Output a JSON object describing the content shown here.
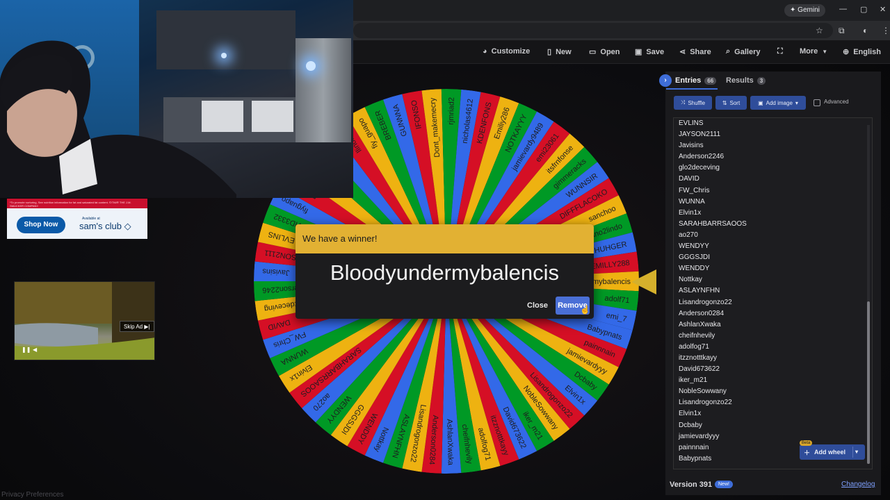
{
  "browser": {
    "gemini_label": "Gemini",
    "window_controls": [
      "—",
      "▢",
      "✕"
    ]
  },
  "toolbar": {
    "items": [
      {
        "label": "Customize",
        "icon": "palette-icon"
      },
      {
        "label": "New",
        "icon": "document-icon"
      },
      {
        "label": "Open",
        "icon": "folder-icon"
      },
      {
        "label": "Save",
        "icon": "save-icon"
      },
      {
        "label": "Share",
        "icon": "share-icon"
      },
      {
        "label": "Gallery",
        "icon": "search-icon"
      },
      {
        "label": "",
        "icon": "fullscreen-icon"
      },
      {
        "label": "More",
        "icon": "chevron-down-icon"
      },
      {
        "label": "English",
        "icon": "globe-icon"
      }
    ]
  },
  "ads": {
    "fine_print": "*To promote nurturing, See nutrition information for fat and saturated fat content. ©/TM/® THE J.M. SMUCKER COMPANY.",
    "shop_now": "Shop Now",
    "available_at": "Available at",
    "brand": "sam's club",
    "skip_ad": "Skip Ad ▶|"
  },
  "privacy": "Privacy Preferences",
  "modal": {
    "header": "We have a winner!",
    "winner": "Bloodyundermybalencis",
    "close": "Close",
    "remove": "Remove"
  },
  "panel": {
    "tab_entries": "Entries",
    "entries_count": "66",
    "tab_results": "Results",
    "results_count": "3",
    "shuffle": "Shuffle",
    "sort": "Sort",
    "add_image": "Add image",
    "advanced": "Advanced",
    "add_wheel": "Add wheel",
    "beta": "Beta",
    "version": "Version 391",
    "new": "New!",
    "changelog": "Changelog",
    "entries": [
      "EVLINS",
      "JAYSON2111",
      "Javisins",
      "Anderson2246",
      "glo2deceving",
      "DAVID",
      "FW_Chris",
      "WUNNA",
      "Elvin1x",
      "SARAHBARRSAOOS",
      "ao270",
      "WENDYY",
      "GGGSJDI",
      "WENDDY",
      "Nottkay",
      "ASLAYNFHN",
      "Lisandrogonzo22",
      "Anderson0284",
      "AshlanXwaka",
      "cheifnhevily",
      "adolfog71",
      "itzznotttkayy",
      "David673622",
      "iker_m21",
      "NobleSowwany",
      "Lisandrogonzo22",
      "Elvin1x",
      "Dcbaby",
      "jamievardyyy",
      "painnnain",
      "Babypnats"
    ]
  },
  "wheel": {
    "colors": [
      "#3369e8",
      "#d50f25",
      "#eeb211",
      "#009925"
    ],
    "labels": [
      "Babypnats",
      "painnnain",
      "jamievardyyy",
      "Dcbaby",
      "Elvin1x",
      "Lisandrogonzo22",
      "NobleSowwany",
      "iker_m21",
      "David673622",
      "itzznotttkayy",
      "adolfog71",
      "cheifnhevily",
      "AshlanXwaka",
      "Anderson0284",
      "Lisandrogonzo22",
      "ASLAYNFHN",
      "Nottkay",
      "WENDDY",
      "GGGSJDI",
      "WENDYY",
      "ao270",
      "SARAHBARRSAOOS",
      "Elvin1x",
      "WUNNA",
      "FW_Chris",
      "DAVID",
      "glo2deceving",
      "Anderson2246",
      "Javisins",
      "JAYSON2111",
      "EVLINS",
      "MVID3332",
      "fiyguapo",
      "pguapdo",
      "PAWUN",
      "Hoiy_Pasa",
      "THACURO",
      "llinoisvic",
      "fiy_guapo",
      "BREBER",
      "GUNNNA",
      "IFONSO",
      "Dont_makemecry",
      "rjmriad2",
      "nicholas4612",
      "KDENFONS",
      "Emiliy286",
      "NOTKAYYY",
      "jamievardy9489",
      "emi23061",
      "itsfrnfonse",
      "gimmeracks",
      "WUNNSIR",
      "DIFFFLACOKO",
      "sanchoo",
      "ano2lindo",
      "THUHGER",
      "EMILLY288",
      "Bloodyundermybalencis",
      "adolf71",
      "emi_7"
    ]
  }
}
